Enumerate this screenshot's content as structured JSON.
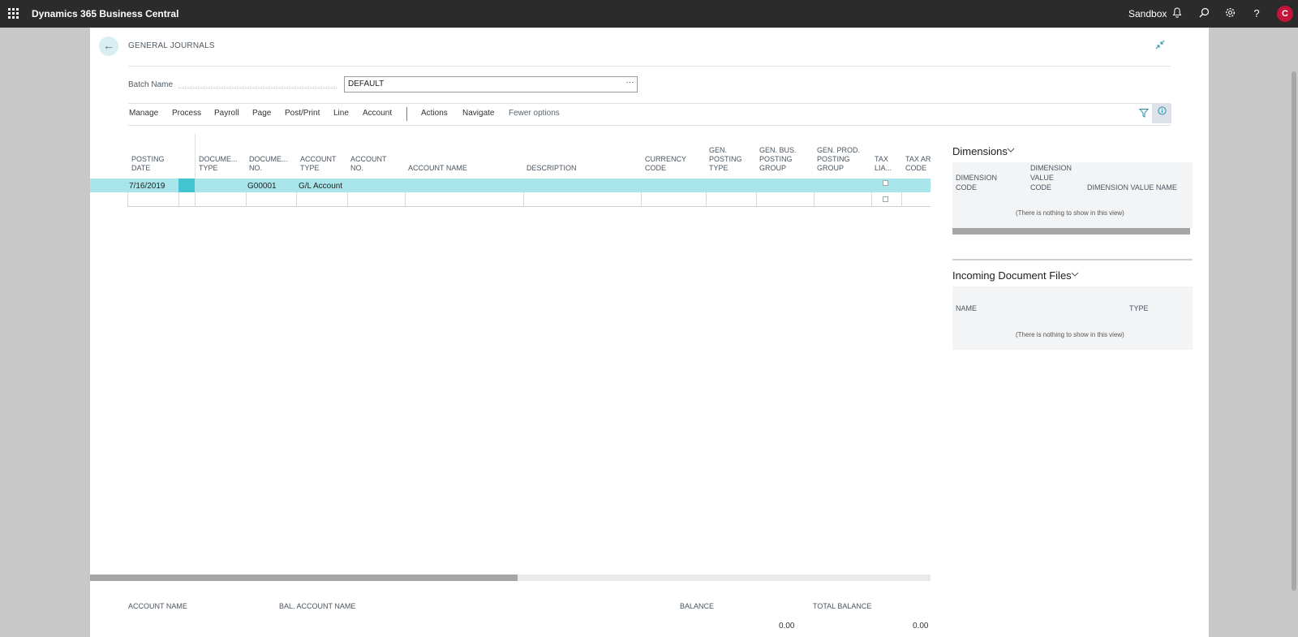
{
  "topbar": {
    "app_title": "Dynamics 365 Business Central",
    "environment": "Sandbox",
    "avatar_initial": "C"
  },
  "page": {
    "caption": "GENERAL JOURNALS",
    "batch_label": "Batch Name",
    "batch_value": "DEFAULT",
    "batch_lookup": "···"
  },
  "actions": {
    "manage": "Manage",
    "process": "Process",
    "payroll": "Payroll",
    "page": "Page",
    "post_print": "Post/Print",
    "line": "Line",
    "account": "Account",
    "actions": "Actions",
    "navigate": "Navigate",
    "fewer": "Fewer options"
  },
  "grid": {
    "headers": {
      "posting_date": [
        "POSTING",
        "DATE"
      ],
      "doc_type": [
        "DOCUME...",
        "TYPE"
      ],
      "doc_no": [
        "DOCUME...",
        "NO."
      ],
      "account_type": [
        "ACCOUNT",
        "TYPE"
      ],
      "account_no": [
        "ACCOUNT",
        "NO."
      ],
      "account_name": [
        "ACCOUNT NAME"
      ],
      "description": [
        "DESCRIPTION"
      ],
      "currency_code": [
        "CURRENCY",
        "CODE"
      ],
      "gen_posting_type": [
        "GEN.",
        "POSTING",
        "TYPE"
      ],
      "gen_bus": [
        "GEN. BUS.",
        "POSTING",
        "GROUP"
      ],
      "gen_prod": [
        "GEN. PROD.",
        "POSTING",
        "GROUP"
      ],
      "tax_lia": [
        "TAX",
        "LIA..."
      ],
      "tax_ar": [
        "TAX AR",
        "CODE"
      ]
    },
    "rows": [
      {
        "posting_date": "7/16/2019",
        "doc_no": "G00001",
        "account_type": "G/L Account"
      }
    ]
  },
  "totals": {
    "account_name_label": "ACCOUNT NAME",
    "bal_account_name_label": "BAL. ACCOUNT NAME",
    "balance_label": "BALANCE",
    "total_balance_label": "TOTAL BALANCE",
    "balance_value": "0.00",
    "total_balance_value": "0.00"
  },
  "factbox": {
    "dimensions": {
      "title": "Dimensions",
      "col1": [
        "DIMENSION",
        "CODE"
      ],
      "col2": [
        "DIMENSION",
        "VALUE",
        "CODE"
      ],
      "col3": "DIMENSION VALUE NAME",
      "empty": "(There is nothing to show in this view)"
    },
    "incoming": {
      "title": "Incoming Document Files",
      "col1": "NAME",
      "col2": "TYPE",
      "empty": "(There is nothing to show in this view)"
    }
  },
  "colors": {
    "topbar": "#2b2b2b",
    "accent": "#2a8fa8",
    "selected_row": "#a8e6ec",
    "avatar": "#c4143c"
  },
  "icons": [
    "waffle-icon",
    "bell-icon",
    "search-icon",
    "gear-icon",
    "help-icon",
    "back-arrow-icon",
    "collapse-icon",
    "filter-icon",
    "info-icon",
    "chevron-down-icon"
  ]
}
